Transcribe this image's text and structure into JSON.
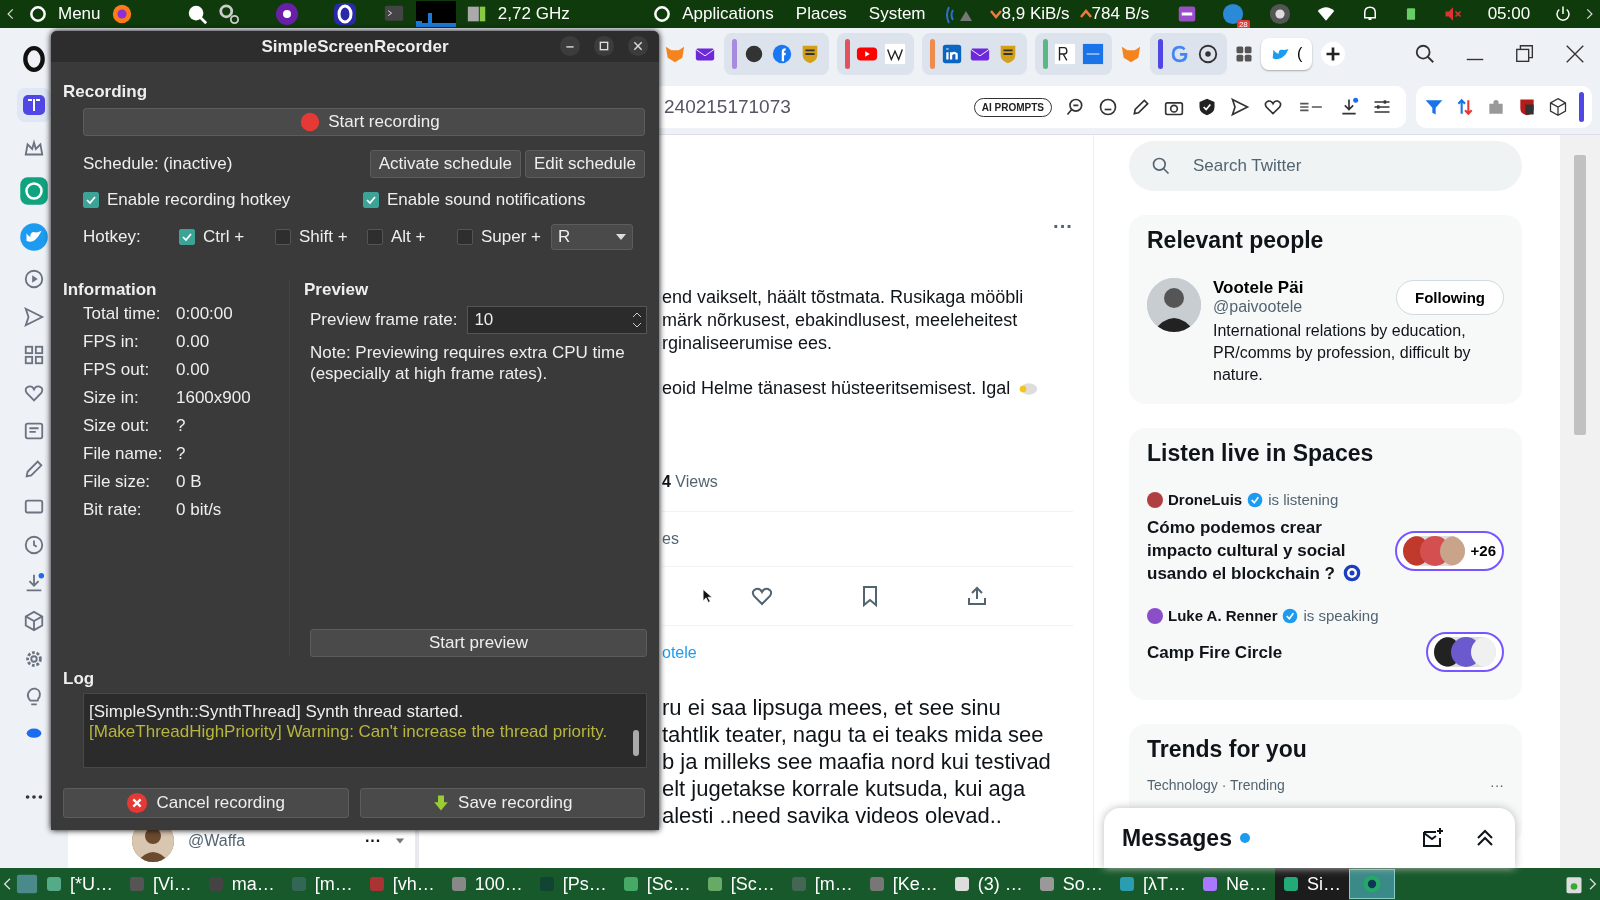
{
  "top_panel": {
    "menu": "Menu",
    "cpu": "2,72 GHz",
    "menus": [
      "Applications",
      "Places",
      "System"
    ],
    "net_down": "8,9 KiB/s",
    "net_up": "784 B/s",
    "badge": "28",
    "clock": "05:00"
  },
  "browser": {
    "active_tab": "(",
    "address": "240215171073",
    "ai_prompts": "AI PROMPTS"
  },
  "side_panel": {
    "handle": "@Waffa",
    "more": "···"
  },
  "tweet": {
    "more": "···",
    "text_lines": [
      "end vaikselt, häält tõstmata. Rusikaga mööbli",
      "märk nõrkusest, ebakindlusest, meeleheitest",
      "rginaliseerumise ees."
    ],
    "text_line_4": "eoid Helme tänasest hüsteeritsemisest. Igal",
    "views_count": "4",
    "views_label": "Views",
    "stats_label": "es"
  },
  "reply": {
    "replying_to": "otele",
    "lines": [
      "ru ei saa lipsuga mees, et see sinu",
      "tahtlik teater, nagu ta ei teaks mida see",
      "b ja milleks see maafia nord kui testivad",
      "elt jugetakse korrale kutsuda, kui aga",
      "alesti ..need savika videos olevad.."
    ]
  },
  "sidebar": {
    "search": {
      "placeholder": "Search Twitter"
    },
    "relevant": {
      "title": "Relevant people",
      "name": "Vootele Päi",
      "handle": "@paivootele",
      "follow": "Following",
      "bio": "International relations by education, PR/comms by profession, difficult by nature."
    },
    "spaces": {
      "title": "Listen live in Spaces",
      "items": [
        {
          "host": "DroneLuis",
          "status": "is listening",
          "title": "Cómo podemos crear impacto cultural y social usando el blockchain ?",
          "count": "+26"
        },
        {
          "host": "Luke A. Renner",
          "status": "is speaking",
          "title": "Camp Fire Circle"
        }
      ]
    },
    "trends": {
      "title": "Trends for you",
      "meta": "Technology · Trending",
      "more": "···"
    },
    "messages": {
      "title": "Messages"
    }
  },
  "recorder": {
    "title": "SimpleScreenRecorder",
    "recording_label": "Recording",
    "start_recording": "Start recording",
    "schedule": "Schedule: (inactive)",
    "activate_schedule": "Activate schedule",
    "edit_schedule": "Edit schedule",
    "options": [
      {
        "label": "Enable recording hotkey",
        "checked": true
      },
      {
        "label": "Enable sound notifications",
        "checked": true
      }
    ],
    "hotkey_label": "Hotkey:",
    "modifiers": [
      {
        "label": "Ctrl +",
        "checked": true
      },
      {
        "label": "Shift +",
        "checked": false
      },
      {
        "label": "Alt +",
        "checked": false
      },
      {
        "label": "Super +",
        "checked": false
      }
    ],
    "key": "R",
    "information_label": "Information",
    "info": [
      {
        "label": "Total time:",
        "value": "0:00:00"
      },
      {
        "label": "FPS in:",
        "value": "0.00"
      },
      {
        "label": "FPS out:",
        "value": "0.00"
      },
      {
        "label": "Size in:",
        "value": "1600x900"
      },
      {
        "label": "Size out:",
        "value": "?"
      },
      {
        "label": "File name:",
        "value": "?"
      },
      {
        "label": "File size:",
        "value": "0 B"
      },
      {
        "label": "Bit rate:",
        "value": "0 bit/s"
      }
    ],
    "preview_label": "Preview",
    "frame_rate_label": "Preview frame rate:",
    "frame_rate": "10",
    "note": "Note: Previewing requires extra CPU time (especially at high frame rates).",
    "start_preview": "Start preview",
    "log_label": "Log",
    "log": [
      {
        "kind": "info",
        "text": "[SimpleSynth::SynthThread] Synth thread started."
      },
      {
        "kind": "warning",
        "text": "[MakeThreadHighPriority] Warning: Can't increase the thread priority."
      }
    ],
    "cancel": "Cancel recording",
    "save": "Save recording"
  },
  "taskbar": [
    {
      "label": "[*U…",
      "selected": false
    },
    {
      "label": "[Vi…",
      "selected": false
    },
    {
      "label": "ma…",
      "selected": false
    },
    {
      "label": "[m…",
      "selected": false
    },
    {
      "label": "[vh…",
      "selected": false
    },
    {
      "label": "100…",
      "selected": false
    },
    {
      "label": "[Ps…",
      "selected": false
    },
    {
      "label": "[Sc…",
      "selected": false
    },
    {
      "label": "[Sc…",
      "selected": false
    },
    {
      "label": "[m…",
      "selected": false
    },
    {
      "label": "[Ke…",
      "selected": false
    },
    {
      "label": "(3) …",
      "selected": false
    },
    {
      "label": "So…",
      "selected": false
    },
    {
      "label": "[λT…",
      "selected": false
    },
    {
      "label": "Ne…",
      "selected": false
    },
    {
      "label": "Si…",
      "selected": true
    }
  ]
}
